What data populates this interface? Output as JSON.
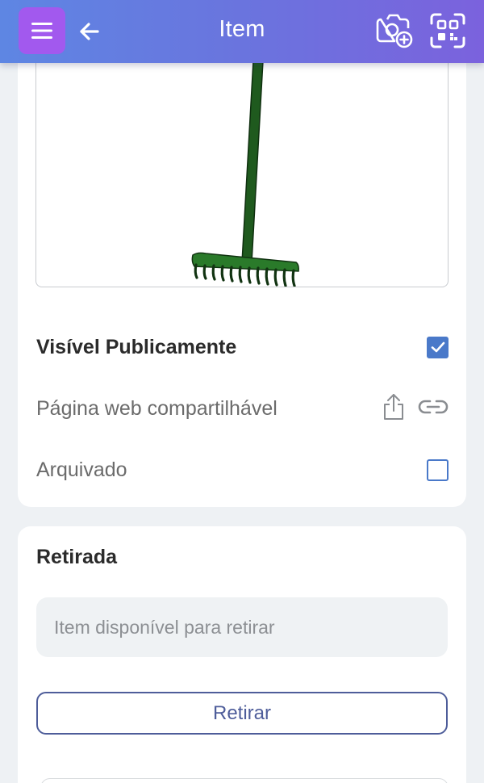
{
  "header": {
    "title": "Item",
    "menu_icon": "hamburger-menu-icon",
    "back_icon": "arrow-left-icon",
    "camera_icon": "camera-add-icon",
    "scan_icon": "qr-scan-icon",
    "gradient_start": "#5e86e3",
    "gradient_end": "#7b62dd",
    "menu_color": "#a259ee"
  },
  "item": {
    "image_subject": "rake",
    "public_label": "Visível Publicamente",
    "public_checked": true,
    "share_label": "Página web compartilhável",
    "share_icon": "share-upload-icon",
    "link_icon": "link-icon",
    "archived_label": "Arquivado",
    "archived_checked": false
  },
  "checkout": {
    "title": "Retirada",
    "status_placeholder": "Item disponível para retirar",
    "button_label": "Retirar"
  },
  "colors": {
    "accent": "#4a79c9",
    "button_text": "#4e5d9a"
  }
}
